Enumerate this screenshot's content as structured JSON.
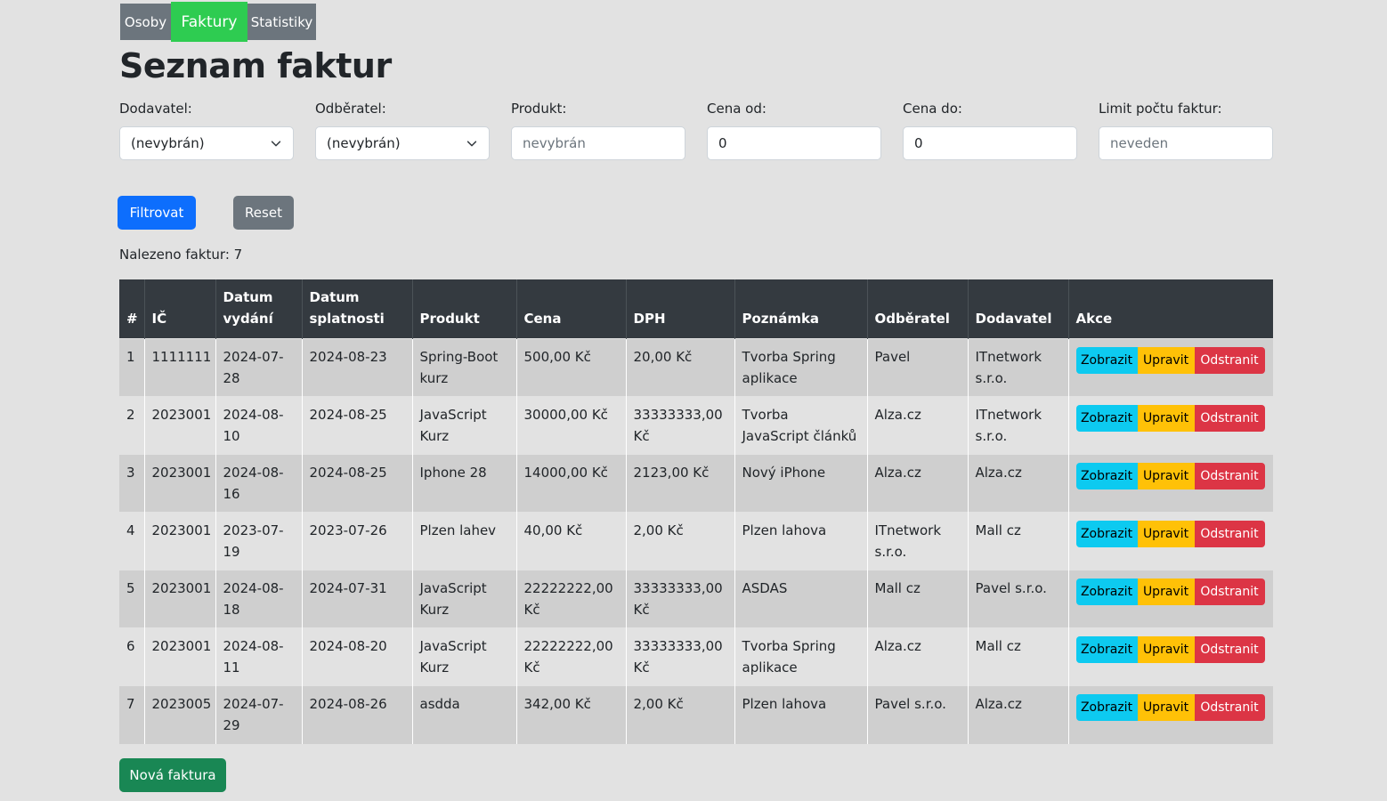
{
  "nav": {
    "items": [
      "Osoby",
      "Faktury",
      "Statistiky"
    ],
    "active": "Faktury"
  },
  "page": {
    "title": "Seznam faktur"
  },
  "filters": {
    "supplier": {
      "label": "Dodavatel:",
      "value": "(nevybrán)"
    },
    "buyer": {
      "label": "Odběratel:",
      "value": "(nevybrán)"
    },
    "product": {
      "label": "Produkt:",
      "placeholder": "nevybrán"
    },
    "price_from": {
      "label": "Cena od:",
      "value": "0"
    },
    "price_to": {
      "label": "Cena do:",
      "value": "0"
    },
    "limit": {
      "label": "Limit počtu faktur:",
      "placeholder": "neveden"
    }
  },
  "buttons": {
    "filter": "Filtrovat",
    "reset": "Reset",
    "new_invoice": "Nová faktura"
  },
  "result": {
    "text": "Nalezeno faktur: 7"
  },
  "table": {
    "headers": {
      "num": "#",
      "ic": "IČ",
      "issued": "Datum vydání",
      "due": "Datum splatnosti",
      "product": "Produkt",
      "price": "Cena",
      "vat": "DPH",
      "note": "Poznámka",
      "buyer": "Odběratel",
      "supplier": "Dodavatel",
      "actions": "Akce"
    },
    "action_labels": {
      "show": "Zobrazit",
      "edit": "Upravit",
      "delete": "Odstranit"
    },
    "rows": [
      {
        "num": "1",
        "ic": "1111111",
        "issued": "2024-07-28",
        "due": "2024-08-23",
        "product": "Spring-Boot kurz",
        "price": "500,00 Kč",
        "vat": "20,00 Kč",
        "note": "Tvorba Spring aplikace",
        "buyer": "Pavel",
        "supplier": "ITnetwork s.r.o."
      },
      {
        "num": "2",
        "ic": "2023001",
        "issued": "2024-08-10",
        "due": "2024-08-25",
        "product": "JavaScript Kurz",
        "price": "30000,00 Kč",
        "vat": "33333333,00 Kč",
        "note": "Tvorba JavaScript článků",
        "buyer": "Alza.cz",
        "supplier": "ITnetwork s.r.o."
      },
      {
        "num": "3",
        "ic": "2023001",
        "issued": "2024-08-16",
        "due": "2024-08-25",
        "product": "Iphone 28",
        "price": "14000,00 Kč",
        "vat": "2123,00 Kč",
        "note": "Nový iPhone",
        "buyer": "Alza.cz",
        "supplier": "Alza.cz"
      },
      {
        "num": "4",
        "ic": "2023001",
        "issued": "2023-07-19",
        "due": "2023-07-26",
        "product": "Plzen lahev",
        "price": "40,00 Kč",
        "vat": "2,00 Kč",
        "note": "Plzen lahova",
        "buyer": "ITnetwork s.r.o.",
        "supplier": "Mall cz"
      },
      {
        "num": "5",
        "ic": "2023001",
        "issued": "2024-08-18",
        "due": "2024-07-31",
        "product": "JavaScript Kurz",
        "price": "22222222,00 Kč",
        "vat": "33333333,00 Kč",
        "note": "ASDAS",
        "buyer": "Mall cz",
        "supplier": "Pavel s.r.o."
      },
      {
        "num": "6",
        "ic": "2023001",
        "issued": "2024-08-11",
        "due": "2024-08-20",
        "product": "JavaScript Kurz",
        "price": "22222222,00 Kč",
        "vat": "33333333,00 Kč",
        "note": "Tvorba Spring aplikace",
        "buyer": "Alza.cz",
        "supplier": "Mall cz"
      },
      {
        "num": "7",
        "ic": "2023005",
        "issued": "2024-07-29",
        "due": "2024-08-26",
        "product": "asdda",
        "price": "342,00 Kč",
        "vat": "2,00 Kč",
        "note": "Plzen lahova",
        "buyer": "Pavel s.r.o.",
        "supplier": "Alza.cz"
      }
    ]
  }
}
